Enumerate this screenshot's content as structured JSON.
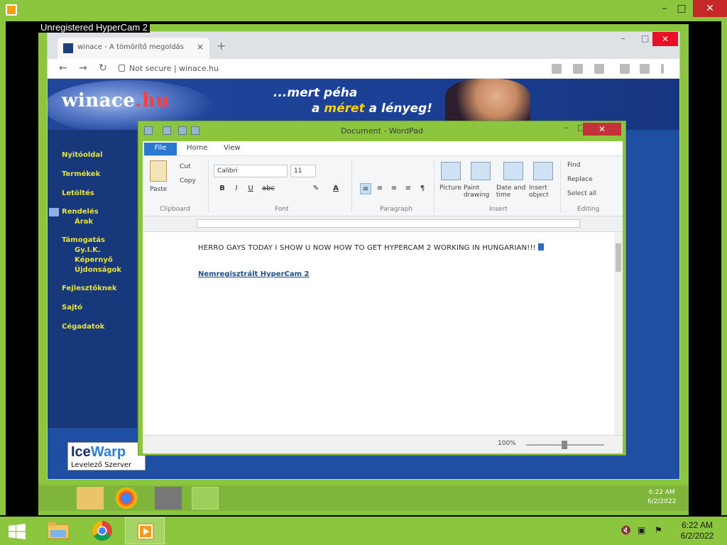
{
  "outer_window": {
    "controls": {
      "minimize": "–",
      "maximize": "□",
      "close": "✕"
    },
    "accent_color": "#8cc63f"
  },
  "hypercam": {
    "label": "Unregistered HyperCam 2"
  },
  "browser": {
    "tab": {
      "title": "winace - A tömörítő megoldás",
      "close": "×"
    },
    "new_tab": "+",
    "controls": {
      "minimize": "–",
      "maximize": "□",
      "close": "✕"
    },
    "nav": {
      "back": "←",
      "forward": "→",
      "reload": "↻"
    },
    "address": {
      "security": "Not secure",
      "separator": "|",
      "url": "winace.hu"
    }
  },
  "site": {
    "logo": {
      "main": "winace",
      "dot_hu": ".hu"
    },
    "slogan": {
      "line1": "...mert péha",
      "line2_pre": "a",
      "line2_highlight": "méret",
      "line2_post": "a lényeg!"
    },
    "sidebar": [
      {
        "label": "Nyitóoldal"
      },
      {
        "label": "Termékek"
      },
      {
        "label": "Letöltés"
      },
      {
        "label": "Rendelés"
      },
      {
        "label": "Árak",
        "sub": true
      },
      {
        "label": "Támogatás"
      },
      {
        "label": "Gy.I.K.",
        "sub": true
      },
      {
        "label": "Képernyő",
        "sub": true
      },
      {
        "label": "Újdonságok",
        "sub": true
      },
      {
        "label": "Fejlesztőknek"
      },
      {
        "label": "Sajtó"
      },
      {
        "label": "Cégadatok"
      }
    ],
    "icewarp": {
      "name_pre": "Ice",
      "name_post": "Warp",
      "subtitle": "Levelező Szerver"
    }
  },
  "wordpad": {
    "title": "Document - WordPad",
    "controls": {
      "minimize": "–",
      "maximize": "□",
      "close": "✕"
    },
    "tabs": [
      "File",
      "Home",
      "View"
    ],
    "ribbon": {
      "clipboard": {
        "paste": "Paste",
        "cut": "Cut",
        "copy": "Copy",
        "group": "Clipboard"
      },
      "font": {
        "family": "Calibri",
        "size": "11",
        "group": "Font"
      },
      "paragraph": {
        "group": "Paragraph"
      },
      "insert": {
        "picture": "Picture",
        "paint": "Paint drawing",
        "datetime": "Date and time",
        "object": "Insert object",
        "group": "Insert"
      },
      "editing": {
        "find": "Find",
        "replace": "Replace",
        "select_all": "Select all",
        "group": "Editing"
      }
    },
    "document": {
      "line1": "HERRO GAYS TODAY I SHOW U NOW HOW TO GET HYPERCAM 2 WORKING IN HUNGARIAN!!!",
      "line2": "Nemregisztrált HyperCam 2"
    },
    "status": {
      "zoom": "100%"
    }
  },
  "inner_taskbar": {
    "time": "6:22 AM",
    "date": "6/2/2022"
  },
  "taskbar": {
    "time": "6:22 AM",
    "date": "6/2/2022"
  }
}
